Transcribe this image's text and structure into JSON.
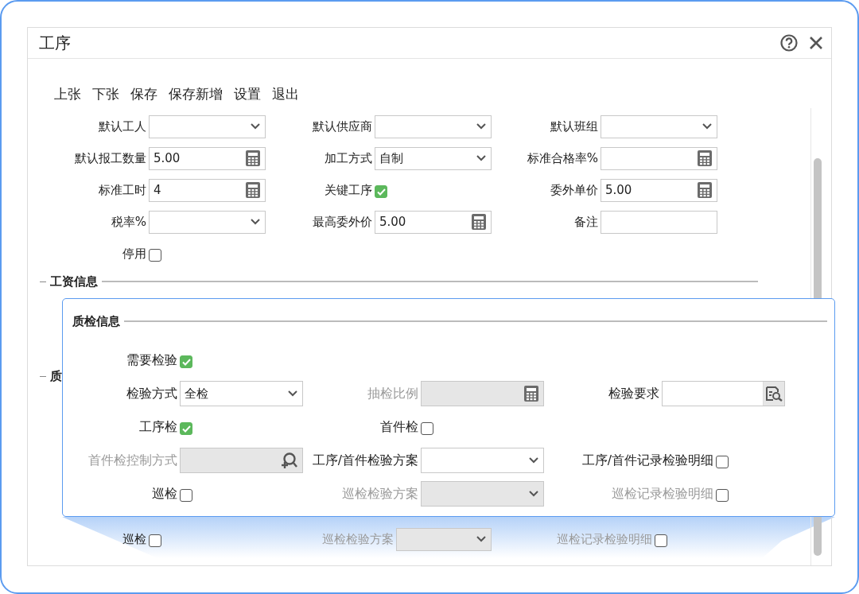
{
  "dialog": {
    "title": "工序"
  },
  "toolbar": [
    "上张",
    "下张",
    "保存",
    "保存新增",
    "设置",
    "退出"
  ],
  "form": {
    "rows": [
      [
        {
          "label": "默认工人",
          "kind": "select",
          "disabled": false
        },
        {
          "label": "默认供应商",
          "kind": "select",
          "disabled": false
        },
        {
          "label": "默认班组",
          "kind": "select",
          "disabled": false
        }
      ],
      [
        {
          "label": "默认报工数量",
          "kind": "number",
          "value": "5.00",
          "disabled": false
        },
        {
          "label": "加工方式",
          "kind": "select",
          "value": "自制",
          "disabled": false
        },
        {
          "label": "标准合格率%",
          "kind": "number",
          "disabled": false
        }
      ],
      [
        {
          "label": "标准工时",
          "kind": "number",
          "value": "4",
          "disabled": false
        },
        {
          "label": "关键工序",
          "kind": "checkbox",
          "checked": true,
          "disabled": false
        },
        {
          "label": "委外单价",
          "kind": "number",
          "value": "5.00",
          "disabled": false
        }
      ],
      [
        {
          "label": "税率%",
          "kind": "select",
          "disabled": false
        },
        {
          "label": "最高委外价",
          "kind": "number",
          "value": "5.00",
          "disabled": false
        },
        {
          "label": "备注",
          "kind": "text",
          "disabled": false
        }
      ],
      [
        {
          "label": "停用",
          "kind": "checkbox",
          "checked": false,
          "disabled": false
        }
      ]
    ]
  },
  "wage_section": {
    "title": "工资信息"
  },
  "quality_section": {
    "title": "质"
  },
  "bottom_row": {
    "cells": [
      {
        "label": "巡检",
        "kind": "checkbox",
        "checked": false,
        "disabled": false
      },
      {
        "label": "巡检检验方案",
        "kind": "select",
        "disabled": true
      },
      {
        "label": "巡检记录检验明细",
        "kind": "checkbox",
        "checked": false,
        "disabled": true
      }
    ]
  },
  "callout": {
    "title": "质检信息",
    "rows": [
      [
        {
          "label": "需要检验",
          "kind": "checkbox",
          "checked": true,
          "disabled": false
        }
      ],
      [
        {
          "label": "检验方式",
          "kind": "select",
          "value": "全检",
          "disabled": false
        },
        {
          "label": "抽检比例",
          "kind": "number",
          "disabled": true
        },
        {
          "label": "检验要求",
          "kind": "lookup",
          "disabled": false
        }
      ],
      [
        {
          "label": "工序检",
          "kind": "checkbox",
          "checked": true,
          "disabled": false
        },
        {
          "label": "首件检",
          "kind": "checkbox",
          "checked": false,
          "disabled": false
        }
      ],
      [
        {
          "label": "首件检控制方式",
          "kind": "search",
          "disabled": true
        },
        {
          "label": "工序/首件检验方案",
          "kind": "select",
          "disabled": false
        },
        {
          "label": "工序/首件记录检验明细",
          "kind": "checkbox",
          "checked": false,
          "disabled": false
        }
      ],
      [
        {
          "label": "巡检",
          "kind": "checkbox",
          "checked": false,
          "disabled": false
        },
        {
          "label": "巡检检验方案",
          "kind": "select",
          "disabled": true
        },
        {
          "label": "巡检记录检验明细",
          "kind": "checkbox",
          "checked": false,
          "disabled": true
        }
      ]
    ]
  }
}
